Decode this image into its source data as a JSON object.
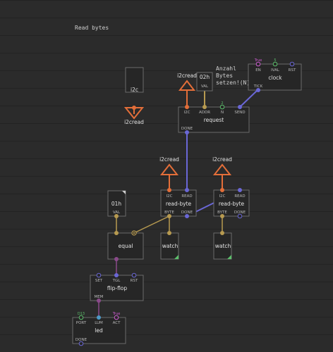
{
  "colors": {
    "i2c_link": "#e36e39",
    "pulse_link": "#6a67d6",
    "byte_link": "#b79a50",
    "bool_link": "#8a4a8a",
    "node_bg": "#262626",
    "node_border": "#6b6b6b",
    "pin_value_green": "#5cbf6b",
    "pin_value_magenta": "#cc5cd0",
    "pin_value_blue": "#4d9ac8"
  },
  "comments": {
    "read_bytes": "Read bytes",
    "anzahl_line1": "Anzahl",
    "anzahl_line2": "Bytes",
    "anzahl_line3": "setzen!(N)"
  },
  "nodes": {
    "i2c_source": {
      "label": "i2c"
    },
    "i2cread_bus_top": {
      "label": "i2cread"
    },
    "i2cread_from_left": {
      "label": "i2cread"
    },
    "addr_const": {
      "label": "02h",
      "pin": "VAL"
    },
    "clock": {
      "label": "clock",
      "pins": [
        "EN",
        "IVAL",
        "RST",
        "TICK"
      ],
      "en_value": "True",
      "ival_value": "5"
    },
    "request": {
      "label": "request",
      "pins": [
        "I2C",
        "ADDR",
        "N",
        "SEND",
        "DONE"
      ],
      "n_value": "2"
    },
    "i2cread_rb1": {
      "label": "i2cread"
    },
    "i2cread_rb2": {
      "label": "i2cread"
    },
    "read_byte_1": {
      "label": "read-byte",
      "pins": [
        "I2C",
        "READ",
        "BYTE",
        "DONE"
      ]
    },
    "read_byte_2": {
      "label": "read-byte",
      "pins": [
        "I2C",
        "READ",
        "BYTE",
        "DONE"
      ]
    },
    "const_01h": {
      "label": "01h",
      "pin": "VAL"
    },
    "equal": {
      "label": "equal"
    },
    "watch_1": {
      "label": "watch"
    },
    "watch_2": {
      "label": "watch"
    },
    "flip_flop": {
      "label": "flip-flop",
      "pins": [
        "SET",
        "TGL",
        "RST",
        "MEM"
      ]
    },
    "led": {
      "label": "led",
      "pins": [
        "PORT",
        "LUM",
        "ACT",
        "DONE"
      ],
      "port_value": "D13",
      "act_value": "True"
    }
  }
}
